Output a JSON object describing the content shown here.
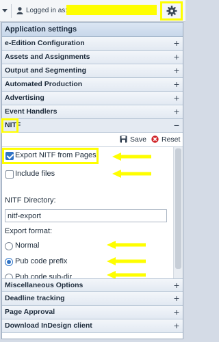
{
  "topbar": {
    "logged_in_label": "Logged in as:",
    "icons": [
      "dropdown-arrow-icon",
      "user-icon",
      "gear-icon"
    ],
    "highlight_color": "#fefe00"
  },
  "panel": {
    "header_title": "Application settings",
    "sections_top": [
      {
        "label": "e-Edition Configuration",
        "toggle": "+"
      },
      {
        "label": "Assets and Assignments",
        "toggle": "+"
      },
      {
        "label": "Output and Segmenting",
        "toggle": "+"
      },
      {
        "label": "Automated Production",
        "toggle": "+"
      },
      {
        "label": "Advertising",
        "toggle": "+"
      },
      {
        "label": "Event Handlers",
        "toggle": "+"
      }
    ],
    "nitf": {
      "label": "NITF",
      "toggle": "−",
      "toolbar": {
        "save_label": "Save",
        "reset_label": "Reset"
      },
      "export_checkbox": {
        "label": "Export NITF from Pages",
        "checked": true
      },
      "include_files": {
        "label": "Include files",
        "checked": false
      },
      "directory_label": "NITF Directory:",
      "directory_value": "nitf-export",
      "format_label": "Export format:",
      "format_options": [
        {
          "label": "Normal",
          "selected": false
        },
        {
          "label": "Pub code prefix",
          "selected": true
        },
        {
          "label": "Pub code sub-dir",
          "selected": false
        }
      ]
    },
    "sections_bottom": [
      {
        "label": "Miscellaneous Options",
        "toggle": "+"
      },
      {
        "label": "Deadline tracking",
        "toggle": "+"
      },
      {
        "label": "Page Approval",
        "toggle": "+"
      },
      {
        "label": "Download InDesign client",
        "toggle": "+"
      }
    ]
  }
}
